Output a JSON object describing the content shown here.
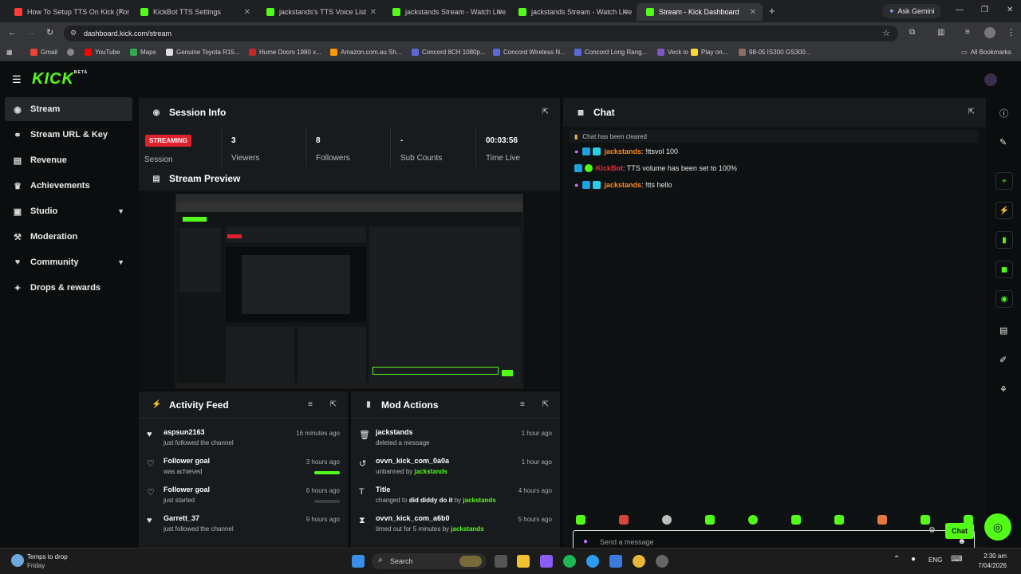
{
  "browser": {
    "tabs": [
      {
        "title": "How To Setup TTS On Kick (For",
        "color": "#ff3b3b"
      },
      {
        "title": "KickBot TTS Settings",
        "color": "#53fc18"
      },
      {
        "title": "jackstands's TTS Voice List | Kick",
        "color": "#53fc18"
      },
      {
        "title": "jackstands Stream - Watch Live",
        "color": "#53fc18"
      },
      {
        "title": "jackstands Stream - Watch Live",
        "color": "#53fc18"
      },
      {
        "title": "Stream - Kick Dashboard",
        "color": "#53fc18"
      }
    ],
    "ask_gemini": "Ask Gemini",
    "url": "dashboard.kick.com/stream",
    "bookmarks": [
      "Gmail",
      "YouTube",
      "Maps",
      "Genuine Toyota R15...",
      "Hume Doors 1980 x...",
      "Amazon.com.au Sh...",
      "Concord 8CH 1080p...",
      "Concord Wireless N...",
      "Concord Long Rang...",
      "Veck io",
      "Play on...",
      "98-05 IS300 GS300..."
    ],
    "all_bookmarks": "All Bookmarks"
  },
  "kick": {
    "logo": "KICK",
    "logo_sup": "BETA",
    "accent": "#53fc18",
    "nav": [
      {
        "label": "Stream",
        "icon": "broadcast-icon"
      },
      {
        "label": "Stream URL & Key",
        "icon": "link-icon"
      },
      {
        "label": "Revenue",
        "icon": "revenue-icon"
      },
      {
        "label": "Achievements",
        "icon": "trophy-icon"
      },
      {
        "label": "Studio",
        "icon": "studio-icon"
      },
      {
        "label": "Moderation",
        "icon": "hammer-icon"
      },
      {
        "label": "Community",
        "icon": "community-icon"
      },
      {
        "label": "Drops & rewards",
        "icon": "gift-icon"
      }
    ],
    "session": {
      "title": "Session Info",
      "status": "STREAMING",
      "label": "Session",
      "stats": [
        {
          "value": "3",
          "label": "Viewers"
        },
        {
          "value": "8",
          "label": "Followers"
        },
        {
          "value": "-",
          "label": "Sub Counts"
        },
        {
          "value": "00:03:56",
          "label": "Time Live"
        }
      ]
    },
    "preview": {
      "title": "Stream Preview"
    },
    "activity": {
      "title": "Activity Feed",
      "items": [
        {
          "name": "aspsun2163",
          "sub": "just followed the channel",
          "time": "16 minutes ago",
          "icon": "heart-filled-icon"
        },
        {
          "name": "Follower goal",
          "sub": "was achieved",
          "time": "3 hours ago",
          "icon": "heart-outline-icon",
          "progress": 1.0
        },
        {
          "name": "Follower goal",
          "sub": "just started",
          "time": "6 hours ago",
          "icon": "heart-outline-icon",
          "progress": 0.0
        },
        {
          "name": "Garrett_37",
          "sub": "just followed the channel",
          "time": "9 hours ago",
          "icon": "heart-filled-icon"
        }
      ]
    },
    "mod": {
      "title": "Mod Actions",
      "items": [
        {
          "name": "jackstands",
          "sub": "deleted a message",
          "time": "1 hour ago",
          "icon": "trash-icon"
        },
        {
          "name": "ovvn_kick_com_0a0a",
          "sub_pre": "unbanned by",
          "sub_user": "jackstands",
          "time": "1 hour ago",
          "icon": "undo-icon"
        },
        {
          "name": "Title",
          "sub_pre": "changed to",
          "sub_bold": "did diddy do it",
          "sub_mid": "by",
          "sub_user": "jackstands",
          "time": "4 hours ago",
          "icon": "title-icon"
        },
        {
          "name": "ovvn_kick_com_a6b0",
          "sub_pre": "timed out for 5 minutes by",
          "sub_user": "jackstands",
          "time": "5 hours ago",
          "icon": "hourglass-icon"
        }
      ]
    },
    "chat": {
      "title": "Chat",
      "cleared": "Chat has been cleared",
      "messages": [
        {
          "user": "jackstands",
          "color": "#ff8a1f",
          "text": ": !ttsvol 100"
        },
        {
          "user": "KickBot",
          "color": "#e0323c",
          "text": ": TTS volume has been set to 100%"
        },
        {
          "user": "jackstands",
          "color": "#ff8a1f",
          "text": ": !tts hello"
        }
      ],
      "placeholder": "Send a message",
      "send_label": "Chat"
    }
  },
  "taskbar": {
    "weather_line1": "Temps to drop",
    "weather_line2": "Friday",
    "search": "Search",
    "lang": "ENG",
    "time": "2:30 am",
    "date": "7/04/2026"
  }
}
